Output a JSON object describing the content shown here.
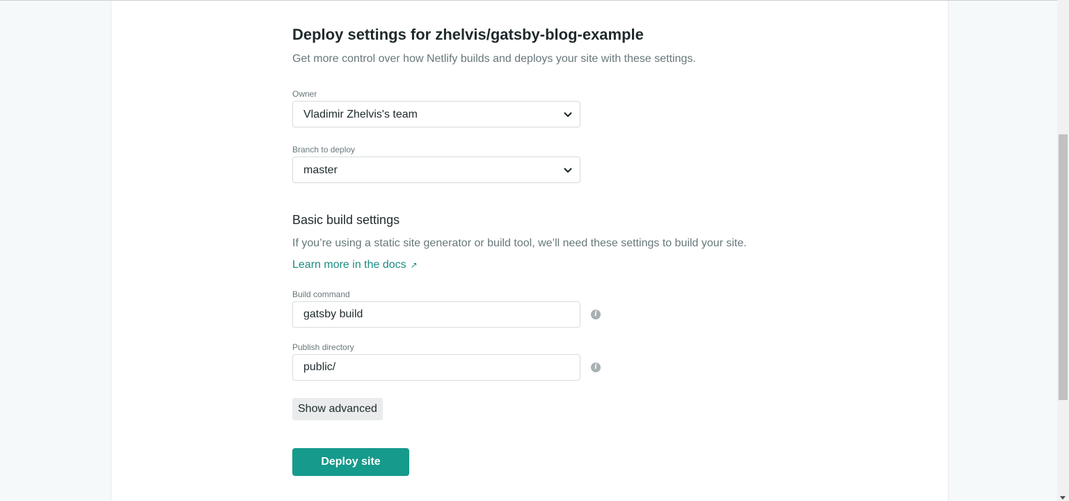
{
  "header": {
    "title": "Deploy settings for zhelvis/gatsby-blog-example",
    "subtitle": "Get more control over how Netlify builds and deploys your site with these settings."
  },
  "owner": {
    "label": "Owner",
    "value": "Vladimir Zhelvis's team"
  },
  "branch": {
    "label": "Branch to deploy",
    "value": "master"
  },
  "build_settings": {
    "heading": "Basic build settings",
    "description": "If you’re using a static site generator or build tool, we’ll need these settings to build your site.",
    "docs_link": "Learn more in the docs",
    "docs_arrow": "↗"
  },
  "build_command": {
    "label": "Build command",
    "value": "gatsby build"
  },
  "publish_directory": {
    "label": "Publish directory",
    "value": "public/"
  },
  "buttons": {
    "advanced": "Show advanced",
    "deploy": "Deploy site"
  },
  "info_glyph": "i",
  "colors": {
    "accent": "#159a8c",
    "link": "#1a8c81"
  }
}
